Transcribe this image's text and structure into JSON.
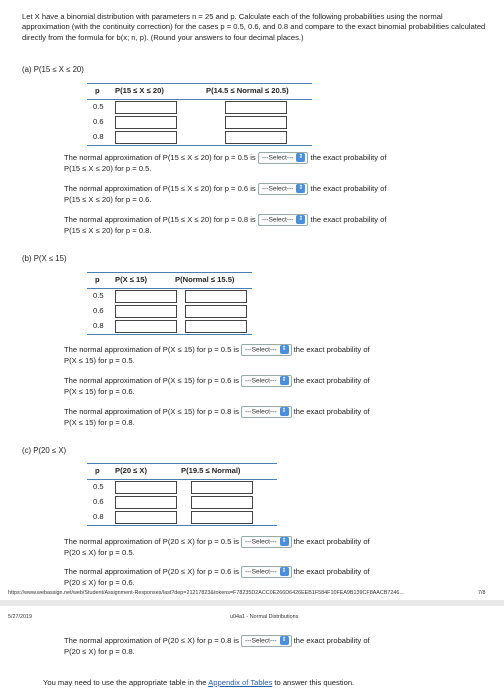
{
  "intro": "Let X have a binomial distribution with parameters n = 25 and p. Calculate each of the following probabilities using the normal approximation (with the continuity correction) for the cases p = 0.5, 0.6, and 0.8 and compare to the exact binomial probabilities calculated directly from the formula for b(x; n, p). (Round your answers to four decimal places.)",
  "p_values": [
    "0.5",
    "0.6",
    "0.8"
  ],
  "select_label": "---Select---",
  "partA": {
    "label": "(a)  P(15 ≤ X ≤ 20)",
    "col1": "p",
    "col2": "P(15 ≤ X ≤ 20)",
    "col3": "P(14.5 ≤ Normal ≤ 20.5)",
    "q1_pre": "The normal approximation of P(15 ≤ X ≤ 20) for p = 0.5 is",
    "q1_post": "the exact probability of",
    "q1_line2": "P(15 ≤ X ≤ 20) for p = 0.5.",
    "q2_pre": "The normal approximation of P(15 ≤ X ≤ 20) for p = 0.6 is",
    "q2_post": "the exact probability of",
    "q2_line2": "P(15 ≤ X ≤ 20) for p = 0.6.",
    "q3_pre": "The normal approximation of P(15 ≤ X ≤ 20) for p = 0.8 is",
    "q3_post": "the exact probability of",
    "q3_line2": "P(15 ≤ X ≤ 20) for p = 0.8."
  },
  "partB": {
    "label": "(b)  P(X ≤ 15)",
    "col1": "p",
    "col2": "P(X ≤ 15)",
    "col3": "P(Normal ≤ 15.5)",
    "q1_pre": "The normal approximation of P(X ≤ 15) for p = 0.5 is",
    "q1_post": "the exact probability of",
    "q1_line2": "P(X ≤ 15) for p = 0.5.",
    "q2_pre": "The normal approximation of P(X ≤ 15) for p = 0.6 is",
    "q2_post": "the exact probability of",
    "q2_line2": "P(X ≤ 15) for p = 0.6.",
    "q3_pre": "The normal approximation of P(X ≤ 15) for p = 0.8 is",
    "q3_post": "the exact probability of",
    "q3_line2": "P(X ≤ 15) for p = 0.8."
  },
  "partC": {
    "label": "(c)  P(20 ≤ X)",
    "col1": "p",
    "col2": "P(20 ≤ X)",
    "col3": "P(19.5 ≤ Normal)",
    "q1_pre": "The normal approximation of P(20 ≤ X) for p = 0.5 is",
    "q1_post": "the exact probability of",
    "q1_line2": "P(20 ≤ X) for p = 0.5.",
    "q2_pre": "The normal approximation of P(20 ≤ X) for p = 0.6 is",
    "q2_post": "the exact probability of",
    "q2_line2": "P(20 ≤ X) for p = 0.6.",
    "q3_pre": "The normal approximation of P(20 ≤ X) for p = 0.8 is",
    "q3_post": "the exact probability of",
    "q3_line2": "P(20 ≤ X) for p = 0.8."
  },
  "footer": {
    "url": "https://www.webassign.net/web/Student/Assignment-Responses/last?dep=21217823&tokens=F78235D2ACC0E266D6426EEB1F584F10FEA9B139CF8AACB7246...",
    "page": "7/8",
    "date": "5/27/2019",
    "header_title": "u04a1 - Normal Distributions"
  },
  "bottom_note_pre": "You may need to use the appropriate table in the",
  "bottom_link": "Appendix of Tables",
  "bottom_note_post": "to answer this question."
}
